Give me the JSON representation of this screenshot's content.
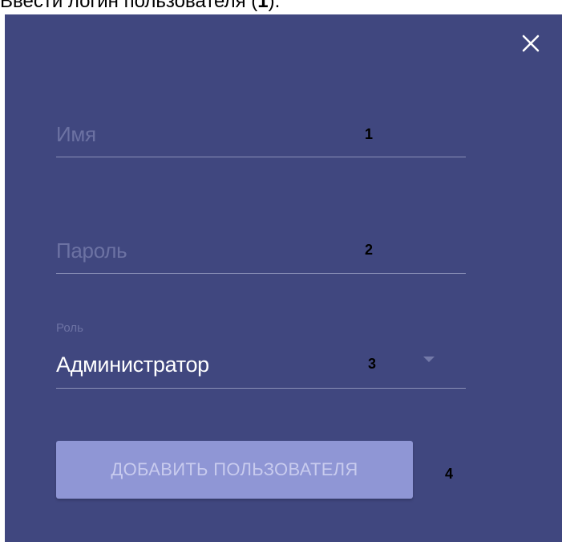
{
  "caption": {
    "text": "Ввести логин пользователя (",
    "bold": "1",
    "suffix": ")."
  },
  "dialog": {
    "close_icon": "close-icon",
    "name_field": {
      "placeholder": "Имя",
      "value": ""
    },
    "password_field": {
      "placeholder": "Пароль",
      "value": ""
    },
    "role_field": {
      "label": "Роль",
      "value": "Администратор",
      "icon": "chevron-down-icon"
    },
    "submit_label": "ДОБАВИТЬ ПОЛЬЗОВАТЕЛЯ"
  },
  "markers": [
    "1",
    "2",
    "3",
    "4"
  ],
  "colors": {
    "panel_bg": "#40477f",
    "button_bg": "#8f96d5",
    "button_text": "#c8cbee",
    "placeholder": "#6c72a3",
    "underline": "#8b90b7"
  }
}
